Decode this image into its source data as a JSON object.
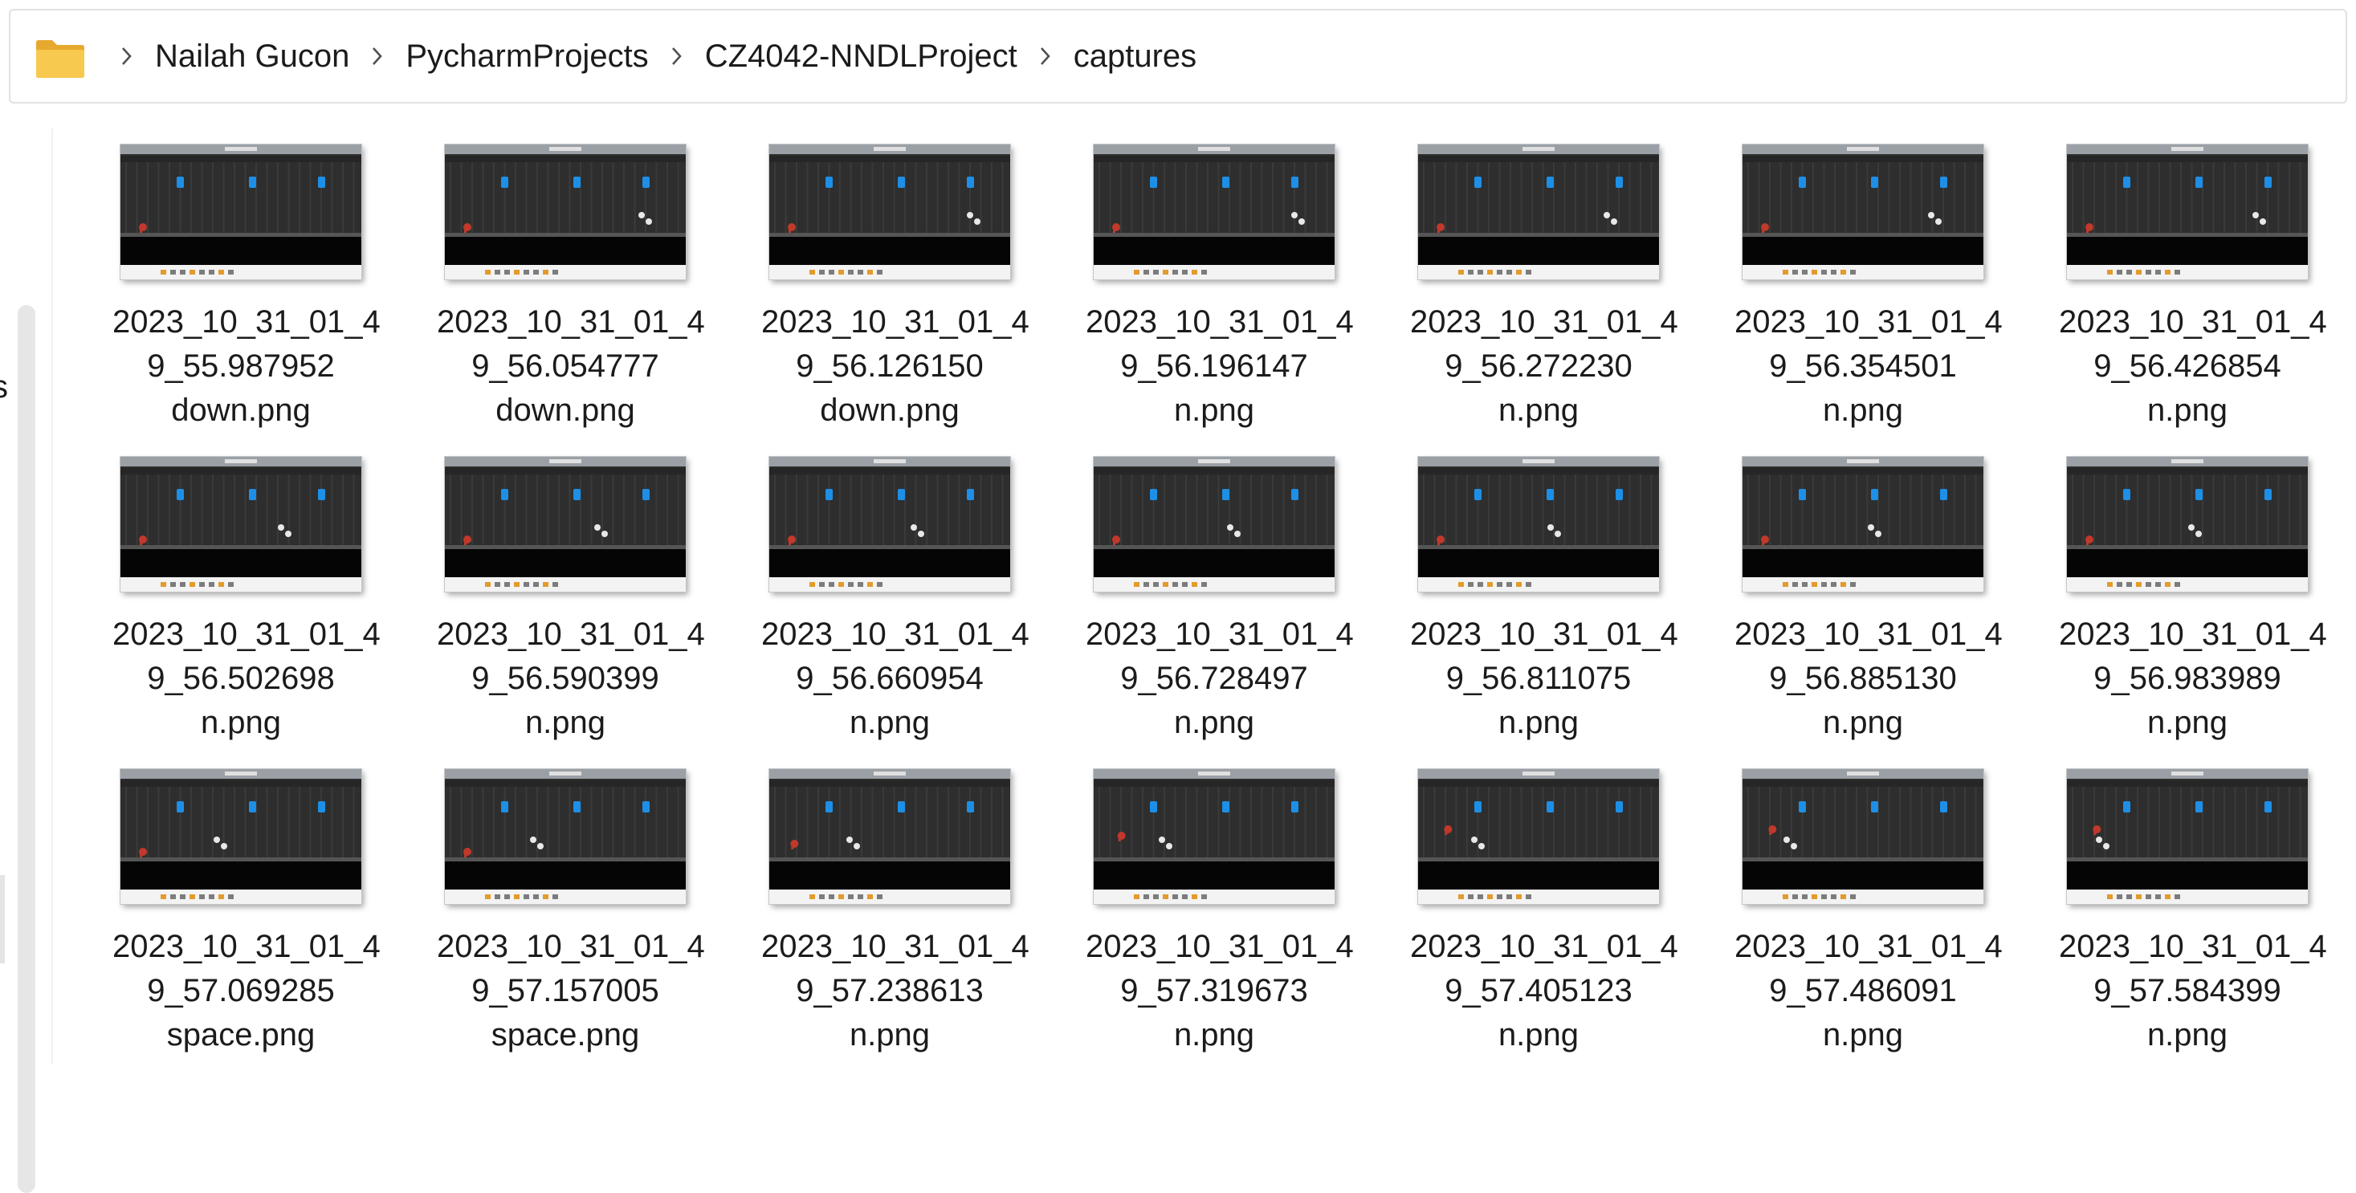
{
  "breadcrumb": [
    "Nailah Gucon",
    "PycharmProjects",
    "CZ4042-NNDLProject",
    "captures"
  ],
  "nav": {
    "partial_label": "s"
  },
  "files": [
    {
      "line1": "2023_10_31_01_4",
      "line2": "9_55.987952",
      "line3": "down.png"
    },
    {
      "line1": "2023_10_31_01_4",
      "line2": "9_56.054777",
      "line3": "down.png"
    },
    {
      "line1": "2023_10_31_01_4",
      "line2": "9_56.126150",
      "line3": "down.png"
    },
    {
      "line1": "2023_10_31_01_4",
      "line2": "9_56.196147",
      "line3": "n.png"
    },
    {
      "line1": "2023_10_31_01_4",
      "line2": "9_56.272230",
      "line3": "n.png"
    },
    {
      "line1": "2023_10_31_01_4",
      "line2": "9_56.354501",
      "line3": "n.png"
    },
    {
      "line1": "2023_10_31_01_4",
      "line2": "9_56.426854",
      "line3": "n.png"
    },
    {
      "line1": "2023_10_31_01_4",
      "line2": "9_56.502698",
      "line3": "n.png"
    },
    {
      "line1": "2023_10_31_01_4",
      "line2": "9_56.590399",
      "line3": "n.png"
    },
    {
      "line1": "2023_10_31_01_4",
      "line2": "9_56.660954",
      "line3": "n.png"
    },
    {
      "line1": "2023_10_31_01_4",
      "line2": "9_56.728497",
      "line3": "n.png"
    },
    {
      "line1": "2023_10_31_01_4",
      "line2": "9_56.811075",
      "line3": "n.png"
    },
    {
      "line1": "2023_10_31_01_4",
      "line2": "9_56.885130",
      "line3": "n.png"
    },
    {
      "line1": "2023_10_31_01_4",
      "line2": "9_56.983989",
      "line3": "n.png"
    },
    {
      "line1": "2023_10_31_01_4",
      "line2": "9_57.069285",
      "line3": "space.png"
    },
    {
      "line1": "2023_10_31_01_4",
      "line2": "9_57.157005",
      "line3": "space.png"
    },
    {
      "line1": "2023_10_31_01_4",
      "line2": "9_57.238613",
      "line3": "n.png"
    },
    {
      "line1": "2023_10_31_01_4",
      "line2": "9_57.319673",
      "line3": "n.png"
    },
    {
      "line1": "2023_10_31_01_4",
      "line2": "9_57.405123",
      "line3": "n.png"
    },
    {
      "line1": "2023_10_31_01_4",
      "line2": "9_57.486091",
      "line3": "n.png"
    },
    {
      "line1": "2023_10_31_01_4",
      "line2": "9_57.584399",
      "line3": "n.png"
    }
  ],
  "colors": {
    "folder": "#f4c34f",
    "game_bg": "#2e2e2e",
    "game_light": "#1d8fe6",
    "player": "#c0392b",
    "obstacle": "#e8e8e8"
  },
  "icons": {
    "folder": "folder-icon",
    "separator": "chevron-right-icon"
  }
}
